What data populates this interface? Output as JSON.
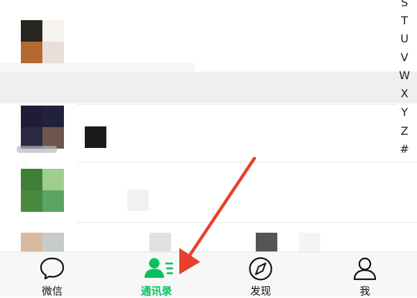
{
  "index_bar": {
    "letters": [
      "S",
      "T",
      "U",
      "V",
      "W",
      "X",
      "Y",
      "Z",
      "#"
    ]
  },
  "tabbar": {
    "tabs": [
      {
        "label": "微信",
        "icon": "chat-bubble-icon",
        "active": false
      },
      {
        "label": "通讯录",
        "icon": "contacts-icon",
        "active": true
      },
      {
        "label": "发现",
        "icon": "compass-icon",
        "active": false
      },
      {
        "label": "我",
        "icon": "person-icon",
        "active": false
      }
    ]
  },
  "colors": {
    "active": "#07c160",
    "arrow": "#e8402a",
    "tabbar_bg": "#f7f7f7",
    "pressed_row_bg": "#efefef"
  }
}
